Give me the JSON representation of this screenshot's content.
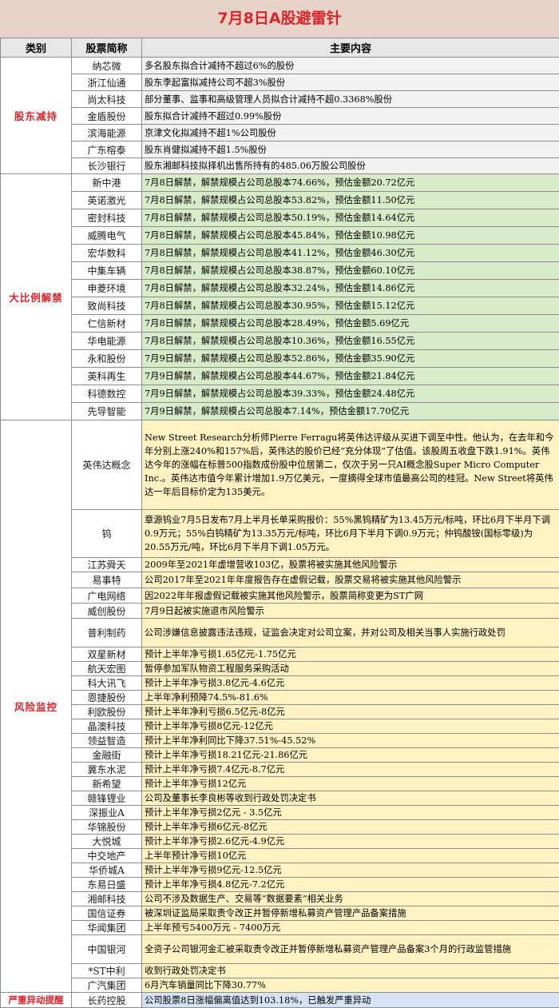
{
  "title": "7月8日A股避雷针",
  "headers": [
    "类别",
    "股票简称",
    "主要内容"
  ],
  "groups": [
    {
      "category": "股东减持",
      "rows": [
        {
          "name": "纳芯微",
          "content": "多名股东拟合计减持不超过6%的股份"
        },
        {
          "name": "浙江仙通",
          "content": "股东李起富拟减持公司不超3%股份"
        },
        {
          "name": "尚太科技",
          "content": "部分董事、监事和高级管理人员拟合计减持不超0.3368%股份"
        },
        {
          "name": "金盾股份",
          "content": "股东拟合计减持不超过0.99%股份"
        },
        {
          "name": "滨海能源",
          "content": "京津文化拟减持不超1%公司股份"
        },
        {
          "name": "广东榕泰",
          "content": "股东肖健拟减持不超1.5%股份"
        },
        {
          "name": "长沙银行",
          "content": "股东湘邮科技拟择机出售所持有的485.06万股公司股份"
        }
      ]
    },
    {
      "category": "大比例解禁",
      "rows": [
        {
          "name": "新中港",
          "content": "7月8日解禁，解禁规模占公司总股本74.66%，预估金额20.72亿元"
        },
        {
          "name": "英诺激光",
          "content": "7月8日解禁，解禁规模占公司总股本53.82%，预估金额11.50亿元"
        },
        {
          "name": "密封科技",
          "content": "7月8日解禁，解禁规模占公司总股本50.19%，预估金额14.64亿元"
        },
        {
          "name": "威腾电气",
          "content": "7月8日解禁，解禁规模占公司总股本45.84%，预估金额10.98亿元"
        },
        {
          "name": "宏华数科",
          "content": "7月8日解禁，解禁规模占公司总股本41.12%，预估金额46.30亿元"
        },
        {
          "name": "中集车辆",
          "content": "7月8日解禁，解禁规模占公司总股本38.87%，预估金额60.10亿元"
        },
        {
          "name": "申菱环境",
          "content": "7月8日解禁，解禁规模占公司总股本32.24%，预估金额14.86亿元"
        },
        {
          "name": "致尚科技",
          "content": "7月8日解禁，解禁规模占公司总股本30.95%，预估金额15.12亿元"
        },
        {
          "name": "仁信新材",
          "content": "7月8日解禁，解禁规模占公司总股本28.49%，预估金额5.69亿元"
        },
        {
          "name": "华电能源",
          "content": "7月8日解禁，解禁规模占公司总股本10.36%，预估金额16.55亿元"
        },
        {
          "name": "永和股份",
          "content": "7月9日解禁，解禁规模占公司总股本52.86%，预估金额35.90亿元"
        },
        {
          "name": "英科再生",
          "content": "7月9日解禁，解禁规模占公司总股本44.67%，预估金额21.84亿元"
        },
        {
          "name": "科德数控",
          "content": "7月9日解禁，解禁规模占公司总股本39.33%，预估金额24.48亿元"
        },
        {
          "name": "先导智能",
          "content": "7月9日解禁，解禁规模占公司总股本7.14%，预估金额17.70亿元"
        }
      ]
    },
    {
      "category": "风险监控",
      "rows": [
        {
          "name": "英伟达概念",
          "content": "New Street Research分析师Pierre Ferragu将英伟达评级从买进下调至中性。他认为，在去年和今年分别上涨240%和157%后，英伟达的股价已经“充分体现”了估值。该股周五收盘下跌1.91%。英伟达今年的涨幅在标普500指数成份股中位居第二，仅次于另一只AI概念股Super Micro Computer Inc.。英伟达市值今年累计增加1.9万亿美元，一度摘得全球市值最高公司的桂冠。New Street将英伟达一年后目标价定为135美元。"
        },
        {
          "name": "钨",
          "content": "章源钨业7月5日发布7月上半月长单采购报价：55%黑钨精矿为13.45万元/标吨，环比6月下半月下调0.9万元；55%白钨精矿为13.35万元/标吨，环比6月下半月下调0.9万元；仲钨酸铵(国标零级)为20.55万元/吨，环比6月下半月下调1.05万元。"
        },
        {
          "name": "江苏舜天",
          "content": "2009年至2021年虚增营收103亿，股票将被实施其他风险警示"
        },
        {
          "name": "易事特",
          "content": "公司2017年至2021年年度报告存在虚假记载，股票交易将被实施其他风险警示"
        },
        {
          "name": "广电网络",
          "content": "因2022年年报虚假记载被实施其他风险警示，股票简称变更为ST广网"
        },
        {
          "name": "威创股份",
          "content": "7月9日起被实施退市风险警示"
        },
        {
          "name": "普利制药",
          "content": "公司涉嫌信息披露违法违规，证监会决定对公司立案，并对公司及相关当事人实施行政处罚"
        },
        {
          "name": "双星新材",
          "content": "预计上半年净亏损1.65亿元-1.75亿元"
        },
        {
          "name": "航天宏图",
          "content": "暂停参加军队物资工程服务采购活动"
        },
        {
          "name": "科大讯飞",
          "content": "预计上半年净亏损3.8亿元-4.6亿元"
        },
        {
          "name": "恩捷股份",
          "content": "上半年净利预降74.5%-81.6%"
        },
        {
          "name": "利欧股份",
          "content": "预计上半年净利亏损6.5亿元-8亿元"
        },
        {
          "name": "晶澳科技",
          "content": "预计上半年净亏损8亿元-12亿元"
        },
        {
          "name": "领益智造",
          "content": "预计上半年净利同比下降37.51%-45.52%"
        },
        {
          "name": "金融街",
          "content": "预计上半年净亏损18.21亿元-21.86亿元"
        },
        {
          "name": "冀东水泥",
          "content": "预计上半年净亏损7.4亿元-8.7亿元"
        },
        {
          "name": "新希望",
          "content": "预计上半年净亏损12亿元"
        },
        {
          "name": "赣锋锂业",
          "content": "公司及董事长李良彬等收到行政处罚决定书"
        },
        {
          "name": "深振业A",
          "content": "预计上半年净亏损2亿元 - 3.5亿元"
        },
        {
          "name": "华锦股份",
          "content": "预计上半年净亏损6亿元-8亿元"
        },
        {
          "name": "大悦城",
          "content": "预计上半年净亏损2.6亿元-4.9亿元"
        },
        {
          "name": "中交地产",
          "content": "上半年预计净亏损10亿元"
        },
        {
          "name": "华侨城A",
          "content": "预计上半年净亏损9亿元-12.5亿元"
        },
        {
          "name": "东易日盛",
          "content": "预计上半年净亏损4.8亿元-7.2亿元"
        },
        {
          "name": "湘邮科技",
          "content": "公司不涉及数据生产、交易等“数据要素”相关业务"
        },
        {
          "name": "国信证券",
          "content": "被深圳证监局采取责令改正并暂停新增私募资产管理产品备案措施"
        },
        {
          "name": "华闻集团",
          "content": "上半年预亏5400万元 - 7400万元"
        },
        {
          "name": "中国银河",
          "content": "全资子公司银河金汇被采取责令改正并暂停新增私募资产管理产品备案3个月的行政监管措施"
        },
        {
          "name": "*ST中利",
          "content": "收到行政处罚决定书"
        },
        {
          "name": "广汽集团",
          "content": "6月汽车销量同比下降30.77%"
        }
      ]
    },
    {
      "category": "严重异动提醒",
      "rows": [
        {
          "name": "长药控股",
          "content": "公司股票8日涨幅偏离值达到103.18%，已触发严重异动"
        }
      ]
    }
  ],
  "colors": {
    "title_bg": "#e6d2c6",
    "title_text": "#d8262c",
    "header_bg": "#e6e6e6",
    "category_text": "#d8262c",
    "group1_bg": "#f2f2f2",
    "group2_bg": "#d8ebc8",
    "group3_bg": "#fff2c2",
    "group4_bg": "#d6e3f4"
  }
}
